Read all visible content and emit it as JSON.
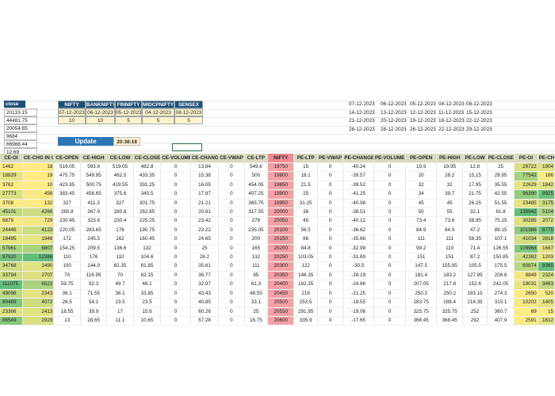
{
  "close_header": "close",
  "close_values": [
    "20133.15",
    "44481.75",
    "20054.65",
    "9684",
    "66988.44",
    "12.69"
  ],
  "indices": {
    "headers": [
      "NIFTY",
      "BANKNIFTY",
      "FINNIFTY",
      "MIDCPNIFTY",
      "SENSEX"
    ],
    "expiry": [
      "07-12-2023",
      "06-12-2023",
      "05-12-2023",
      "04-12-2023",
      "08-12-2023"
    ],
    "strike_step": [
      "10",
      "10",
      "5",
      "5",
      "5"
    ]
  },
  "update": {
    "label": "Update",
    "time": "20:38:18"
  },
  "expiry_dates": [
    [
      "07-12-2023",
      "06-12-2023",
      "05-12-2023",
      "04-12-2023",
      "08-12-2023"
    ],
    [
      "14-12-2023",
      "13-12-2023",
      "12-12-2023",
      "11-12-2023",
      "15-12-2023"
    ],
    [
      "21-12-2023",
      "20-12-2023",
      "19-12-2023",
      "18-12-2023",
      "22-12-2023"
    ],
    [
      "28-12-2023",
      "28-12-2023",
      "26-12-2023",
      "22-12-2023",
      "29-12-2023"
    ]
  ],
  "colors": {
    "header_blue": "#1f4e79",
    "update_blue": "#2e75b6",
    "nifty_red": "#f4a1a6",
    "oi_green_high": "#63be7b",
    "oi_yellow_low": "#ffeb84"
  },
  "table": {
    "columns": [
      "CE-OI",
      "CE-CHG IN OI",
      "CE-OPEN",
      "CE-HIGH",
      "CE-LOW",
      "CE-CLOSE",
      "CE-VOLUME",
      "CE-CHANGE",
      "CE-VWAP",
      "CE-LTP",
      "NIFTY",
      "PE-LTP",
      "PE-VWAP",
      "PE-CHANGE",
      "PE-VOLUME",
      "PE-OPEN",
      "PE-HIGH",
      "PE-LOW",
      "PE-CLOSE",
      "PE-OI",
      "PE-CHG IN"
    ],
    "rows": [
      [
        "1462",
        "18",
        "519.05",
        "593.6",
        "519.05",
        "482.8",
        "0",
        "13.84",
        "0",
        "549.6",
        "19750",
        "15",
        "0",
        "-40.24",
        "0",
        "19.9",
        "19.95",
        "12.8",
        "25",
        "29722",
        "1904"
      ],
      [
        "18829",
        "19",
        "475.75",
        "549.95",
        "462.5",
        "433.35",
        "0",
        "15.38",
        "0",
        "500",
        "19800",
        "18.1",
        "0",
        "-39.57",
        "0",
        "20",
        "28.2",
        "15.15",
        "29.95",
        "77542",
        "186"
      ],
      [
        "3762",
        "10",
        "423.95",
        "500.75",
        "419.55",
        "391.25",
        "0",
        "16.05",
        "0",
        "454.05",
        "19850",
        "21.5",
        "0",
        "-39.52",
        "0",
        "32",
        "32",
        "17.95",
        "35.55",
        "22629",
        "1842"
      ],
      [
        "27773",
        "456",
        "383.45",
        "456.65",
        "375.6",
        "345.5",
        "0",
        "17.87",
        "0",
        "407.25",
        "19900",
        "25",
        "0",
        "-41.25",
        "0",
        "34",
        "39.7",
        "21.75",
        "42.55",
        "96390",
        "8925"
      ],
      [
        "3708",
        "132",
        "327",
        "411.3",
        "327",
        "301.75",
        "0",
        "21.21",
        "0",
        "365.75",
        "19950",
        "31.25",
        "0",
        "-40.98",
        "0",
        "45",
        "45",
        "26.25",
        "51.55",
        "23485",
        "3175"
      ],
      [
        "45101",
        "4266",
        "280.8",
        "367.9",
        "280.8",
        "262.85",
        "0",
        "20.81",
        "0",
        "317.55",
        "20000",
        "38",
        "0",
        "-38.51",
        "0",
        "50",
        "55",
        "32.1",
        "61.8",
        "138942",
        "5104"
      ],
      [
        "6879",
        "729",
        "230.45",
        "323.6",
        "230.4",
        "225.25",
        "0",
        "23.42",
        "0",
        "278",
        "20050",
        "45",
        "0",
        "-40.12",
        "0",
        "73.4",
        "73.6",
        "38.95",
        "75.15",
        "30285",
        "2072"
      ],
      [
        "24446",
        "4123",
        "220.05",
        "283.65",
        "176",
        "190.75",
        "0",
        "23.22",
        "0",
        "235.05",
        "20100",
        "56.5",
        "0",
        "-36.62",
        "0",
        "84.9",
        "84.9",
        "47.2",
        "89.15",
        "101986",
        "8775"
      ],
      [
        "18495",
        "1948",
        "172",
        "245.5",
        "162",
        "160.45",
        "0",
        "24.65",
        "0",
        "200",
        "20150",
        "66",
        "0",
        "-35.68",
        "0",
        "111",
        "111",
        "58.35",
        "107.1",
        "41034",
        "2818"
      ],
      [
        "57961",
        "6807",
        "154.25",
        "209.5",
        "136.6",
        "132",
        "0",
        "25",
        "0",
        "165",
        "20200",
        "84.8",
        "0",
        "-32.99",
        "0",
        "99.2",
        "110",
        "71.4",
        "126.55",
        "109968",
        "1687"
      ],
      [
        "97920",
        "12386",
        "110",
        "176",
        "110",
        "104.6",
        "0",
        "26.2",
        "0",
        "132",
        "20250",
        "103.05",
        "0",
        "-31.69",
        "0",
        "151",
        "151",
        "87.2",
        "150.85",
        "42382",
        "1203"
      ],
      [
        "34768",
        "2490",
        "100",
        "144.9",
        "82.35",
        "81.85",
        "0",
        "35.61",
        "0",
        "111",
        "20300",
        "122",
        "0",
        "-30.5",
        "0",
        "147.5",
        "155.95",
        "105.5",
        "175.5",
        "60874",
        "9365"
      ],
      [
        "33794",
        "2707",
        "70",
        "116.95",
        "70",
        "62.15",
        "0",
        "36.77",
        "0",
        "85",
        "20350",
        "148.35",
        "0",
        "-28.19",
        "0",
        "181.4",
        "183.2",
        "127.85",
        "206.6",
        "8849",
        "2324"
      ],
      [
        "111075",
        "6522",
        "59.75",
        "92.3",
        "49.7",
        "46.1",
        "0",
        "32.97",
        "0",
        "61.3",
        "20400",
        "182.35",
        "0",
        "-24.66",
        "0",
        "207.05",
        "217.8",
        "152.6",
        "242.05",
        "19031",
        "3463"
      ],
      [
        "49098",
        "2343",
        "36.1",
        "71.55",
        "36.1",
        "33.85",
        "0",
        "43.43",
        "0",
        "48.55",
        "20450",
        "216",
        "0",
        "-21.25",
        "0",
        "250.2",
        "250.2",
        "183.15",
        "274.3",
        "2650",
        "520"
      ],
      [
        "89489",
        "4072",
        "26.5",
        "54.1",
        "23.5",
        "23.5",
        "0",
        "40.85",
        "0",
        "33.1",
        "20500",
        "253.5",
        "0",
        "-19.55",
        "0",
        "283.75",
        "288.4",
        "216.35",
        "315.1",
        "10202",
        "1405"
      ],
      [
        "23386",
        "2413",
        "18.55",
        "39.9",
        "17",
        "15.6",
        "0",
        "60.26",
        "0",
        "25",
        "20550",
        "291.95",
        "0",
        "-19.06",
        "0",
        "325.75",
        "325.75",
        "252",
        "360.7",
        "69",
        "15"
      ],
      [
        "86549",
        "2929",
        "13",
        "28.65",
        "11.1",
        "10.65",
        "0",
        "57.28",
        "0",
        "16.75",
        "20600",
        "335.9",
        "0",
        "-17.65",
        "0",
        "368.45",
        "368.45",
        "292",
        "407.9",
        "2591",
        "1612"
      ]
    ]
  }
}
